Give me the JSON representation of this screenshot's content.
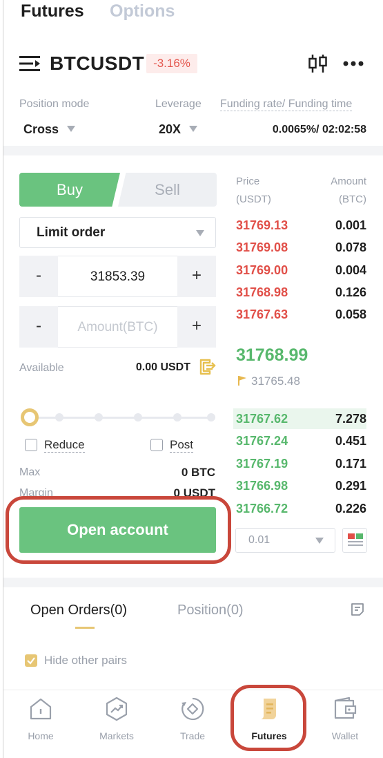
{
  "top_tabs": {
    "futures": "Futures",
    "options": "Options"
  },
  "header": {
    "symbol": "BTCUSDT",
    "change": "-3.16%"
  },
  "info": {
    "position_mode_label": "Position mode",
    "position_mode_value": "Cross",
    "leverage_label": "Leverage",
    "leverage_value": "20X",
    "funding_label": "Funding rate/ Funding time",
    "funding_value": "0.0065%/ 02:02:58"
  },
  "trade": {
    "buy_label": "Buy",
    "sell_label": "Sell",
    "order_type": "Limit order",
    "price_value": "31853.39",
    "minus": "-",
    "plus": "+",
    "amount_placeholder": "Amount(BTC)",
    "available_label": "Available",
    "available_value": "0.00 USDT",
    "slider_percent": 0,
    "reduce_label": "Reduce",
    "post_label": "Post",
    "max_label": "Max",
    "max_value": "0 BTC",
    "margin_label": "Margin",
    "margin_value": "0 USDT",
    "open_account_label": "Open account"
  },
  "orderbook": {
    "price_header_1": "Price",
    "price_header_2": "(USDT)",
    "amount_header_1": "Amount",
    "amount_header_2": "(BTC)",
    "asks": [
      {
        "price": "31769.13",
        "amount": "0.001"
      },
      {
        "price": "31769.08",
        "amount": "0.078"
      },
      {
        "price": "31769.00",
        "amount": "0.004"
      },
      {
        "price": "31768.98",
        "amount": "0.126"
      },
      {
        "price": "31767.63",
        "amount": "0.058"
      }
    ],
    "last_price": "31768.99",
    "mark_price": "31765.48",
    "bids": [
      {
        "price": "31767.62",
        "amount": "7.278"
      },
      {
        "price": "31767.24",
        "amount": "0.451"
      },
      {
        "price": "31767.19",
        "amount": "0.171"
      },
      {
        "price": "31766.98",
        "amount": "0.291"
      },
      {
        "price": "31766.72",
        "amount": "0.226"
      }
    ],
    "precision": "0.01"
  },
  "orders": {
    "open_orders_tab": "Open Orders(0)",
    "position_tab": "Position(0)",
    "hide_pairs_label": "Hide other pairs"
  },
  "nav": [
    {
      "label": "Home",
      "icon": "home-icon"
    },
    {
      "label": "Markets",
      "icon": "markets-icon"
    },
    {
      "label": "Trade",
      "icon": "trade-icon"
    },
    {
      "label": "Futures",
      "icon": "futures-icon"
    },
    {
      "label": "Wallet",
      "icon": "wallet-icon"
    }
  ],
  "colors": {
    "green": "#6ac37f",
    "red": "#e14f48",
    "gold": "#e7c674",
    "highlight": "#c9473b"
  }
}
